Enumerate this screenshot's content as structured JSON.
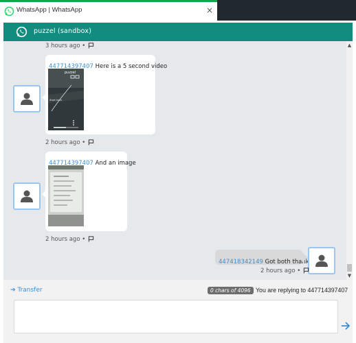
{
  "browser": {
    "tab_title": "WhatsApp | WhatsApp",
    "tab_close": "×"
  },
  "header": {
    "title": "puzzel (sandbox)"
  },
  "chat": {
    "first_meta": "3 hours ago •",
    "messages": [
      {
        "sender": "447714397407",
        "text": " Here is a 5 second video",
        "meta": "2 hours ago •",
        "media_overlay_brand": "puzzel",
        "media_overlay_caption": "Start here"
      },
      {
        "sender": "447714397407",
        "text": " And an image",
        "meta": "2 hours ago •"
      },
      {
        "sender": "447418342149",
        "text": " Got both thanks",
        "meta": "2 hours ago •"
      }
    ]
  },
  "composer": {
    "transfer_label": "➔ Transfer",
    "chars_badge": "0 chars of 4096",
    "replying_text": "You are replying to 447714397407",
    "input_value": "",
    "input_placeholder": ""
  },
  "colors": {
    "header": "#128c7e",
    "chat_bg": "#e6e9ec",
    "link": "#3b8fd6",
    "tab_accent": "#17a34a"
  },
  "icons": {
    "tab": "whatsapp-icon",
    "header": "whatsapp-icon",
    "avatar": "person-icon",
    "flag": "flag-icon",
    "send": "arrow-right-icon"
  }
}
